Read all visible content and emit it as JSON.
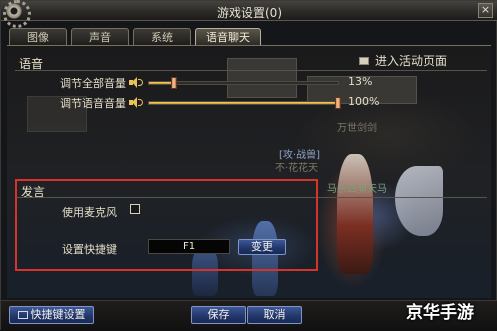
{
  "window": {
    "title": "游戏设置(0)",
    "close_glyph": "×"
  },
  "tabs": [
    {
      "label": "图像",
      "active": false
    },
    {
      "label": "声音",
      "active": false
    },
    {
      "label": "系统",
      "active": false
    },
    {
      "label": "语音聊天",
      "active": true
    }
  ],
  "voice_section": {
    "title": "语音",
    "enter_activity_label": "进入活动页面",
    "sliders": [
      {
        "label": "调节全部音量",
        "value": 13,
        "display": "13%"
      },
      {
        "label": "调节语音音量",
        "value": 100,
        "display": "100%"
      }
    ]
  },
  "speak_section": {
    "title": "发言",
    "mic_label": "使用麦克风",
    "mic_checked": false,
    "hotkey_label": "设置快捷键",
    "hotkey_value": "F1",
    "change_button": "变更"
  },
  "scene_labels": [
    "万世剑剑",
    "[攻·战兽]",
    "不·花花天",
    "马杀四骑天马"
  ],
  "footer": {
    "shortcut_button": "快捷键设置",
    "save_button": "保存",
    "cancel_button": "取消"
  },
  "watermark": "京华手游",
  "colors": {
    "accent_red": "#d8332b",
    "slider_fill": "#f6d56a",
    "button_blue": "#213568"
  }
}
